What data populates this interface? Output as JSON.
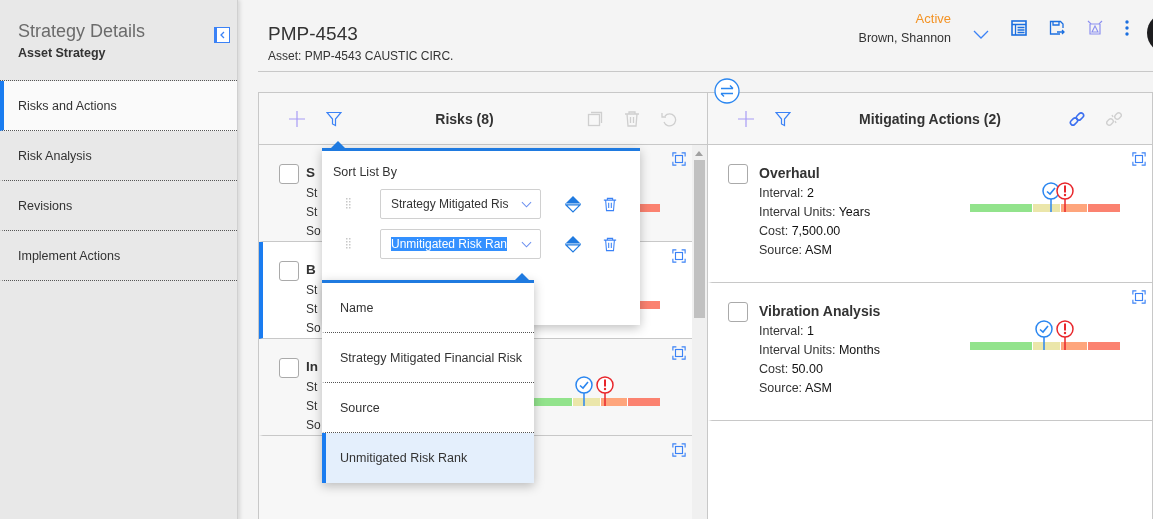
{
  "sidebar": {
    "title": "Strategy Details",
    "subtitle": "Asset Strategy",
    "items": [
      {
        "label": "Risks and Actions",
        "selected": true
      },
      {
        "label": "Risk Analysis",
        "selected": false
      },
      {
        "label": "Revisions",
        "selected": false
      },
      {
        "label": "Implement Actions",
        "selected": false
      }
    ]
  },
  "header": {
    "title": "PMP-4543",
    "asset": "Asset: PMP-4543 CAUSTIC CIRC.",
    "status": "Active",
    "owner": "Brown, Shannon"
  },
  "risks_panel": {
    "title": "Risks (8)",
    "cards": [
      {
        "selected": false,
        "checked": false,
        "name": "S",
        "lines": [
          "St",
          "St",
          "So"
        ]
      },
      {
        "selected": true,
        "checked": false,
        "name": "B",
        "lines": [
          "St",
          "St",
          "So"
        ]
      },
      {
        "selected": false,
        "checked": false,
        "name": "In",
        "lines": [
          "St",
          "St",
          "So"
        ],
        "markers": [
          {
            "kind": "mitigated",
            "level": 0.49
          },
          {
            "kind": "unmitigated",
            "level": 0.63
          }
        ]
      },
      {
        "selected": false
      }
    ]
  },
  "sort_popup": {
    "title": "Sort List By",
    "criteria": [
      {
        "value": "Strategy Mitigated Ris",
        "text_selected": false
      },
      {
        "value": "Unmitigated Risk Ran",
        "text_selected": true
      }
    ],
    "options": [
      {
        "label": "Name",
        "selected": false
      },
      {
        "label": "Strategy Mitigated Financial Risk",
        "selected": false
      },
      {
        "label": "Source",
        "selected": false
      },
      {
        "label": "Unmitigated Risk Rank",
        "selected": true
      }
    ]
  },
  "actions_panel": {
    "title": "Mitigating Actions (2)",
    "cards": [
      {
        "checked": false,
        "name": "Overhaul",
        "lines": [
          "Interval: **2**",
          "Interval Units: **Years**",
          "Cost: **7,500.00**",
          "Source: **ASM**"
        ],
        "markers": [
          {
            "kind": "mitigated",
            "level": 0.54
          },
          {
            "kind": "unmitigated",
            "level": 0.63
          }
        ]
      },
      {
        "checked": false,
        "name": "Vibration Analysis",
        "lines": [
          "Interval: **1**",
          "Interval Units: **Months**",
          "Cost: **50.00**",
          "Source: **ASM**"
        ],
        "markers": [
          {
            "kind": "mitigated",
            "level": 0.49
          },
          {
            "kind": "unmitigated",
            "level": 0.63
          }
        ]
      }
    ]
  }
}
